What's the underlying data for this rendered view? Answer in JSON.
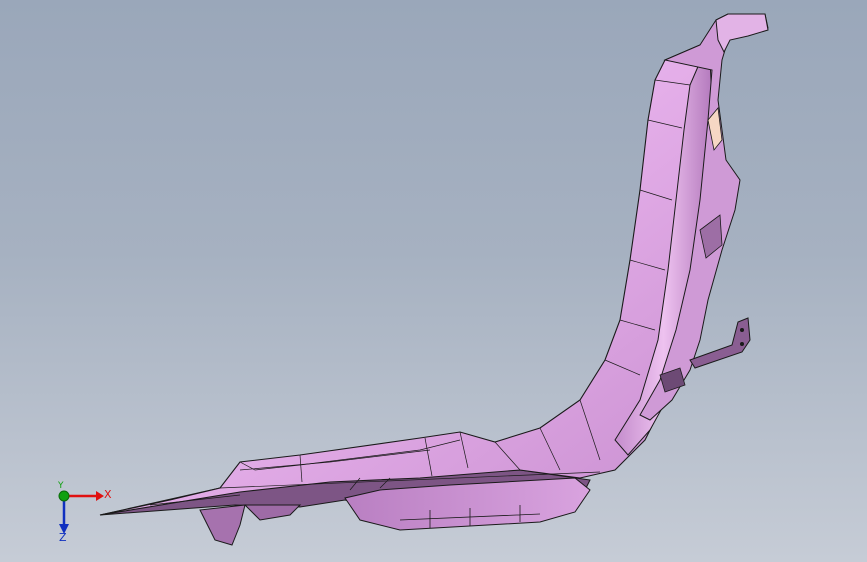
{
  "viewport": {
    "background_top": "#9aa7ba",
    "background_bottom": "#c6ccd6"
  },
  "model": {
    "part_color": "#e8b5ec",
    "edge_color": "#1a1a1a"
  },
  "triad": {
    "x_label": "X",
    "y_label": "Y",
    "z_label": "Z",
    "x_color": "#e01010",
    "y_color": "#10a010",
    "z_color": "#1030c0"
  }
}
